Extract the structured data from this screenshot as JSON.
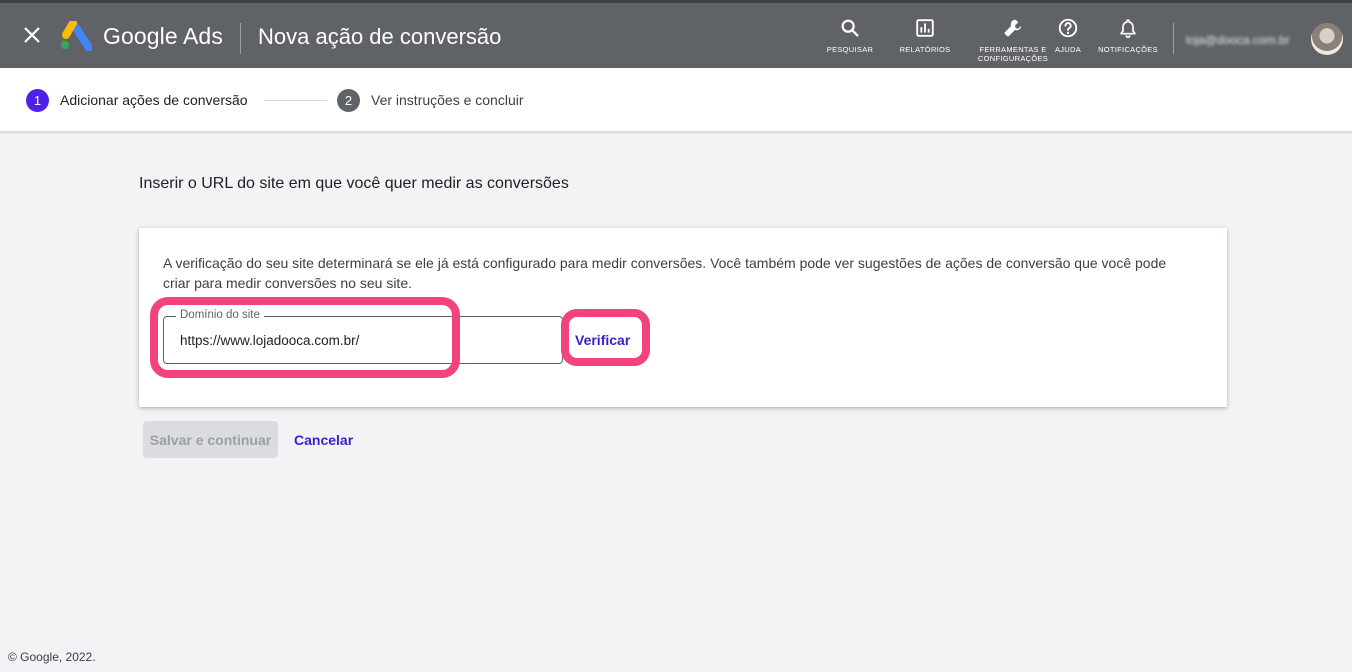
{
  "header": {
    "brand": "Google Ads",
    "title": "Nova ação de conversão",
    "tools": {
      "search": "PESQUISAR",
      "reports": "RELATÓRIOS",
      "tools_line1": "FERRAMENTAS E",
      "tools_line2": "CONFIGURAÇÕES",
      "help": "AJUDA",
      "notifications": "NOTIFICAÇÕES"
    },
    "account_email": "loja@dooca.com.br"
  },
  "stepper": {
    "steps": [
      {
        "number": "1",
        "label": "Adicionar ações de conversão"
      },
      {
        "number": "2",
        "label": "Ver instruções e concluir"
      }
    ]
  },
  "main": {
    "heading": "Inserir o URL do site em que você quer medir as conversões",
    "description": "A verificação do seu site determinará se ele já está configurado para medir conversões. Você também pode ver sugestões de ações de conversão que você pode criar para medir conversões no seu site.",
    "domain_field": {
      "label": "Domínio do site",
      "value": "https://www.lojadooca.com.br/"
    },
    "verify_label": "Verificar"
  },
  "actions": {
    "save_label": "Salvar e continuar",
    "cancel_label": "Cancelar"
  },
  "footer": {
    "copyright": "© Google, 2022."
  },
  "colors": {
    "topbar": "#5f6368",
    "accent": "#4d1fe8",
    "link": "#3a1fd1",
    "highlight": "#f2437f"
  },
  "icons": {
    "close": "close-icon",
    "logo": "google-ads-logo-icon",
    "search": "search-icon",
    "reports": "bar-chart-icon",
    "tools": "wrench-icon",
    "help": "help-icon",
    "notifications": "bell-icon"
  }
}
